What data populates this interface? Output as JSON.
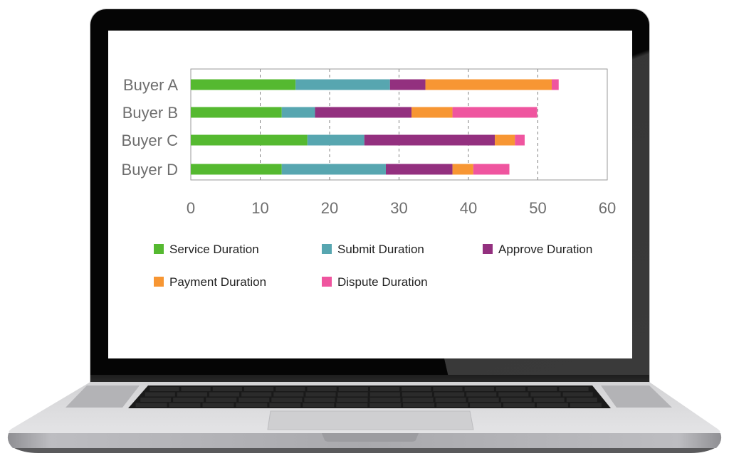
{
  "chart_data": {
    "type": "bar",
    "orientation": "horizontal",
    "stacked": true,
    "title": "",
    "xlabel": "",
    "ylabel": "",
    "xlim": [
      0,
      60
    ],
    "xticks": [
      0,
      10,
      20,
      30,
      40,
      50,
      60
    ],
    "grid": "vertical dashed",
    "legend_position": "bottom",
    "categories": [
      "Buyer A",
      "Buyer B",
      "Buyer C",
      "Buyer D"
    ],
    "series": [
      {
        "name": "Service Duration",
        "color": "#55b930",
        "values": [
          15.1,
          13.1,
          16.8,
          13.1
        ]
      },
      {
        "name": "Submit Duration",
        "color": "#57a6b0",
        "values": [
          13.6,
          4.8,
          8.2,
          15.0
        ]
      },
      {
        "name": "Approve Duration",
        "color": "#93307f",
        "values": [
          5.1,
          13.9,
          18.8,
          9.6
        ]
      },
      {
        "name": "Payment Duration",
        "color": "#f79633",
        "values": [
          18.2,
          5.9,
          2.9,
          3.0
        ]
      },
      {
        "name": "Dispute Duration",
        "color": "#ef559f",
        "values": [
          1.0,
          12.2,
          1.4,
          5.2
        ]
      }
    ]
  },
  "legend": {
    "items": [
      {
        "label": "Service Duration",
        "color": "#55b930"
      },
      {
        "label": "Submit Duration",
        "color": "#57a6b0"
      },
      {
        "label": "Approve Duration",
        "color": "#93307f"
      },
      {
        "label": "Payment Duration",
        "color": "#f79633"
      },
      {
        "label": "Dispute Duration",
        "color": "#ef559f"
      }
    ]
  },
  "colors": {
    "axis_text": "#6e6e6e",
    "frame": "#9a9a9a",
    "grid": "#808080"
  }
}
